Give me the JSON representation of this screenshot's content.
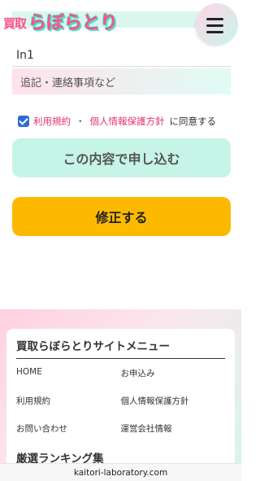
{
  "header": {
    "logo_prefix": "買取",
    "logo_main": "らぼらとり",
    "menu_icon": "hamburger-icon"
  },
  "form": {
    "partial_field_value": "",
    "field_value": "In1",
    "notes_placeholder": "追記・連絡事項など",
    "agree": {
      "checked": true,
      "terms_link": "利用規約",
      "separator": "・",
      "privacy_link": "個人情報保護方針",
      "suffix": "に同意する"
    },
    "submit_label": "この内容で申し込む",
    "edit_label": "修正する"
  },
  "footer": {
    "menu_title": "買取らぼらとりサイトメニュー",
    "links": [
      "HOME",
      "お申込み",
      "利用規約",
      "個人情報保護方針",
      "お問い合わせ",
      "運営会社情報"
    ],
    "ranking_title": "厳選ランキング集"
  },
  "browser": {
    "url": "kaitori-laboratory.com"
  },
  "colors": {
    "accent_pink": "#e8336a",
    "submit_bg": "#c6f4e6",
    "edit_bg": "#fdb900",
    "checkbox": "#2d6bd6"
  }
}
